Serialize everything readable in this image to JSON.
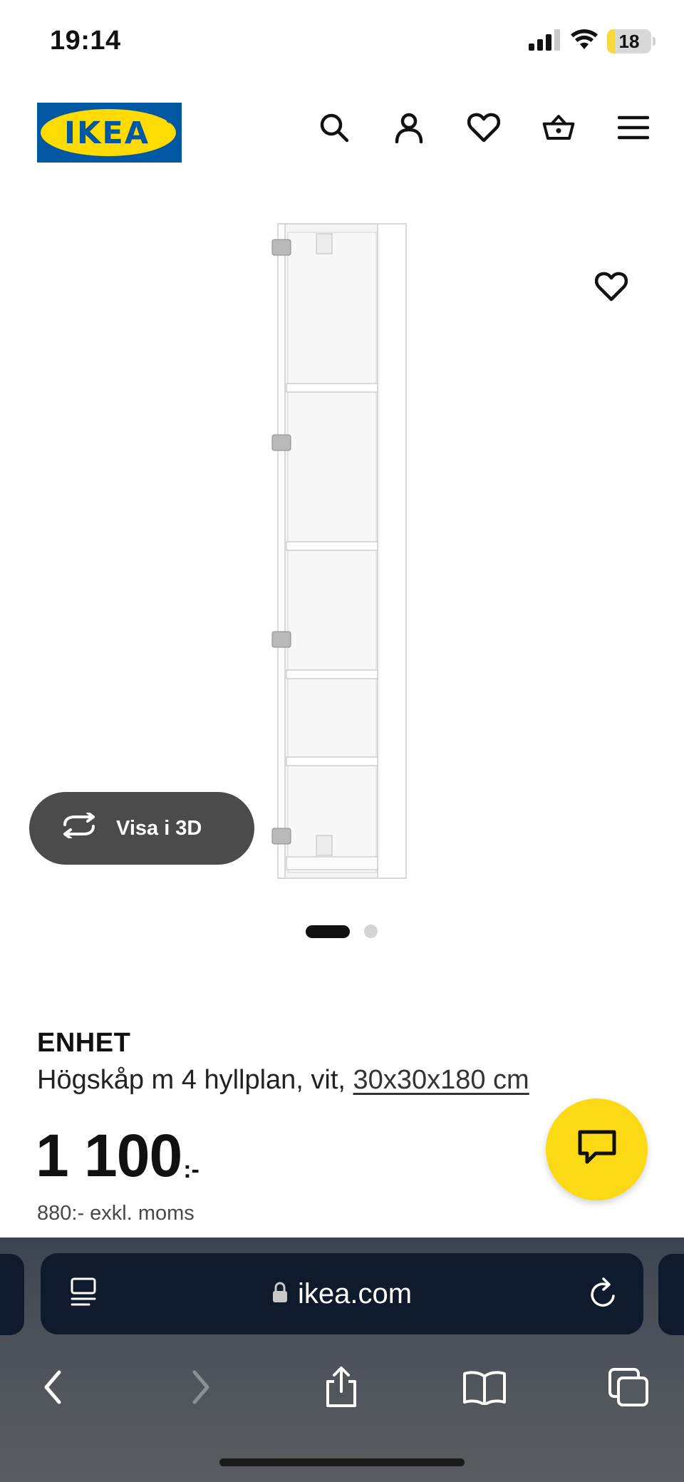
{
  "status_bar": {
    "time": "19:14",
    "battery_level": "18",
    "battery_fraction": 0.18
  },
  "header": {
    "logo_text": "IKEA",
    "icons": [
      "search-icon",
      "profile-icon",
      "heart-icon",
      "basket-icon",
      "menu-icon"
    ]
  },
  "gallery": {
    "view_3d_label": "Visa i 3D",
    "image_count": 2,
    "active_image": 1
  },
  "product": {
    "name": "ENHET",
    "description": "Högskåp m 4 hyllplan, vit,",
    "dimensions": "30x30x180 cm",
    "price": "1 100",
    "price_suffix": ":-",
    "price_excl_vat": "880:- exkl. moms"
  },
  "browser": {
    "url": "ikea.com",
    "icons": [
      "reader-icon",
      "lock-icon",
      "reload-icon",
      "back-icon",
      "forward-icon",
      "share-icon",
      "bookmarks-icon",
      "tabs-icon"
    ]
  },
  "colors": {
    "ikea_blue": "#0058a3",
    "ikea_yellow": "#ffdb00",
    "chat_yellow": "#fbd914",
    "pill_gray": "#4b4b4b",
    "url_bar": "#0f1b2d"
  }
}
